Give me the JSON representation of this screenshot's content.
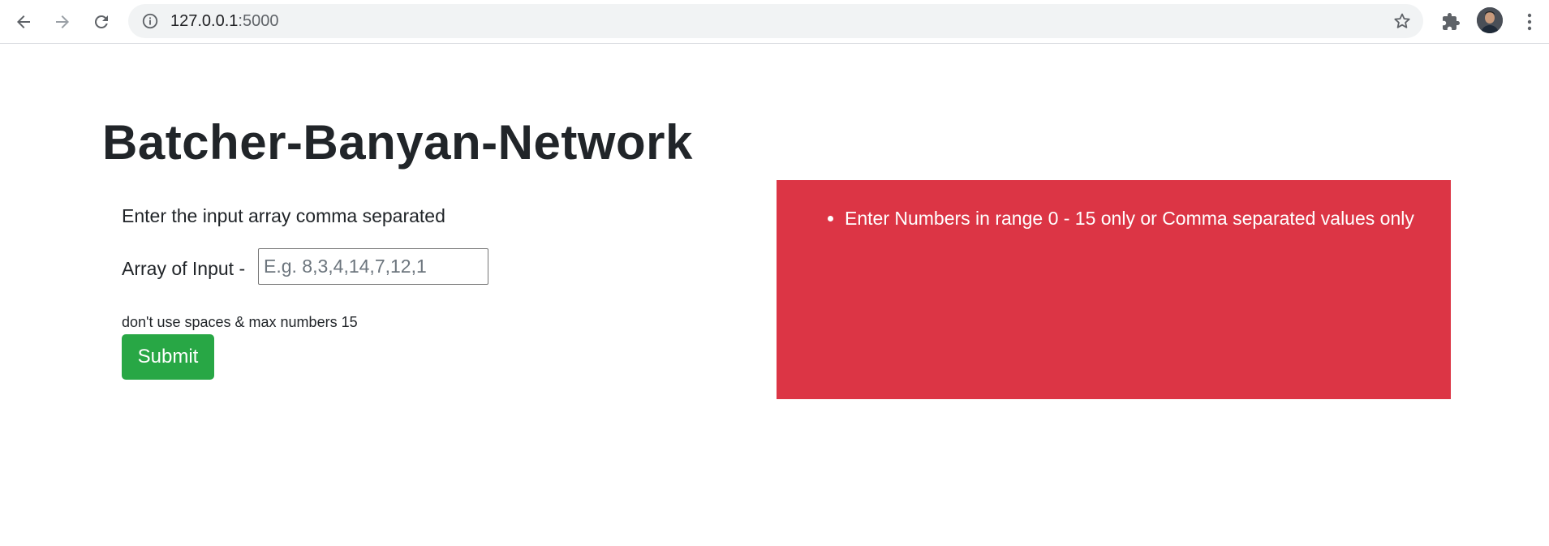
{
  "browser": {
    "url_host": "127.0.0.1",
    "url_port": ":5000"
  },
  "page": {
    "title": "Batcher-Banyan-Network",
    "instruction": "Enter the input array comma separated",
    "array_label": "Array of Input -",
    "input": {
      "value": "",
      "placeholder": "E.g. 8,3,4,14,7,12,1"
    },
    "hint": "don't use spaces & max numbers 15",
    "submit_label": "Submit"
  },
  "error": {
    "messages": [
      "Enter Numbers in range 0 - 15 only or Comma separated values only"
    ]
  },
  "colors": {
    "error_bg": "#dc3545",
    "submit_bg": "#28a745",
    "omnibox_bg": "#f1f3f4"
  },
  "icons": {
    "back": "back-arrow-icon",
    "forward": "forward-arrow-icon",
    "reload": "reload-icon",
    "site_info": "info-icon",
    "bookmark": "star-icon",
    "extensions": "puzzle-icon",
    "profile": "avatar",
    "menu": "kebab-menu-icon"
  }
}
